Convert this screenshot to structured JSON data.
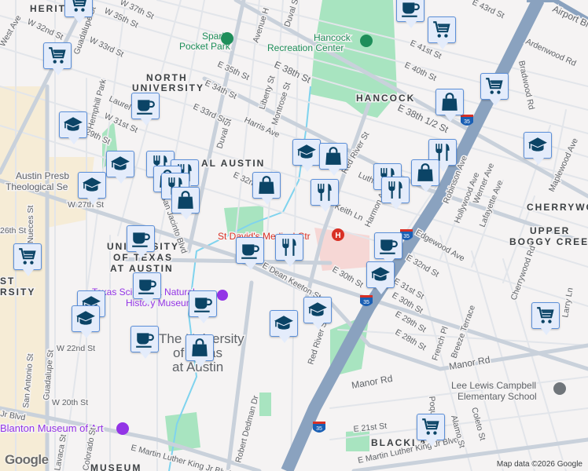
{
  "map": {
    "neighborhoods": [
      "HERIT",
      "NORTH",
      "UNIVERSITY",
      "AL AUSTIN",
      "HANCOCK",
      "CHERRYWOOD",
      "UPPER",
      "BOGGY CREEK",
      "UNIVERSITY",
      "OF TEXAS",
      "AT AUSTIN",
      "ST",
      "RSITY",
      "MUSEUM",
      "BLACKLA"
    ],
    "parks": [
      "Sparky",
      "Pocket Park",
      "Hancock",
      "Recreation Center"
    ],
    "pois": {
      "hospital": "St David's Medical Ctr",
      "presbyterian_1": "Austin Presb",
      "presbyterian_2": "Theological Se",
      "museum_1": "Texas Science & Natural",
      "museum_2": "History Museum",
      "ut_1": "The University",
      "ut_2": "of Texas",
      "ut_3": "at Austin",
      "blanton": "Blanton Museum of Art",
      "school_1": "Lee Lewis Campbell",
      "school_2": "Elementary School"
    },
    "streets": [
      "W 37th St",
      "W 35th St",
      "W 32nd St",
      "West Ave",
      "Guadalupe St",
      "W 33rd St",
      "Hemphill Park",
      "Laurel",
      "W 31st St",
      "29th St",
      "E 35th St",
      "E 34th St",
      "E 33rd St",
      "Harris Ave",
      "Duval St",
      "Liberty St",
      "Montrose St",
      "Avenue H",
      "Duval St",
      "E 38th St",
      "E 32nd St",
      "San Jacinto Blvd",
      "W 27th St",
      "Nueces St",
      "26th St",
      "E 43rd St",
      "Airport Blvd",
      "E 41st St",
      "E 40th St",
      "Ardenwood Rd",
      "Bradwood Rd",
      "E 38th 1/2 St",
      "Red River St",
      "Luther Ln",
      "Keith Ln",
      "Harmon Ave",
      "Robinson Ave",
      "Hollywood Ave",
      "Werner Ave",
      "Lafayette Ave",
      "Maplewood Ave",
      "Edgewood Ave",
      "E 32nd St",
      "E 31st St",
      "E 30th St",
      "E 30th St",
      "E 29th St",
      "E 28th St",
      "French Pl",
      "Breeze Terrace",
      "Cherrywood Rd",
      "Larry Ln",
      "Manor Rd",
      "Manor Rd",
      "E Dean Keeton St",
      "Red River St",
      "W 22nd St",
      "San Antonio St",
      "Guadalupe St",
      "W 20th St",
      "Jr Blvd",
      "E Martin Luther King Jr Blvd",
      "E Martin Luther King Jr Blvd",
      "E 21st St",
      "Robert Dedman Dr",
      "Alamo St",
      "Coleto St",
      "Poquito St",
      "Lavaca St",
      "Colorado St"
    ],
    "highway_shield": "35",
    "attribution": "Map data ©2026 Google",
    "logo": "Google",
    "colors": {
      "marker_fill": "#e4ecfb",
      "marker_icon": "#0b4466",
      "park": "#a8e4c0",
      "highway": "#8aa2bf",
      "campus": "#f6ecd6"
    }
  },
  "markers": [
    "grocery",
    "grocery",
    "cafe",
    "school",
    "school",
    "school",
    "restaurant",
    "restaurant",
    "shopping",
    "shopping",
    "cafe",
    "cafe",
    "restaurant",
    "grocery",
    "cafe",
    "school",
    "school",
    "cafe",
    "school",
    "school",
    "cafe",
    "shopping",
    "cafe",
    "grocery",
    "shopping",
    "grocery",
    "school",
    "school",
    "shopping",
    "restaurant",
    "restaurant",
    "shopping",
    "restaurant",
    "restaurant",
    "cafe",
    "school",
    "grocery",
    "grocery"
  ]
}
